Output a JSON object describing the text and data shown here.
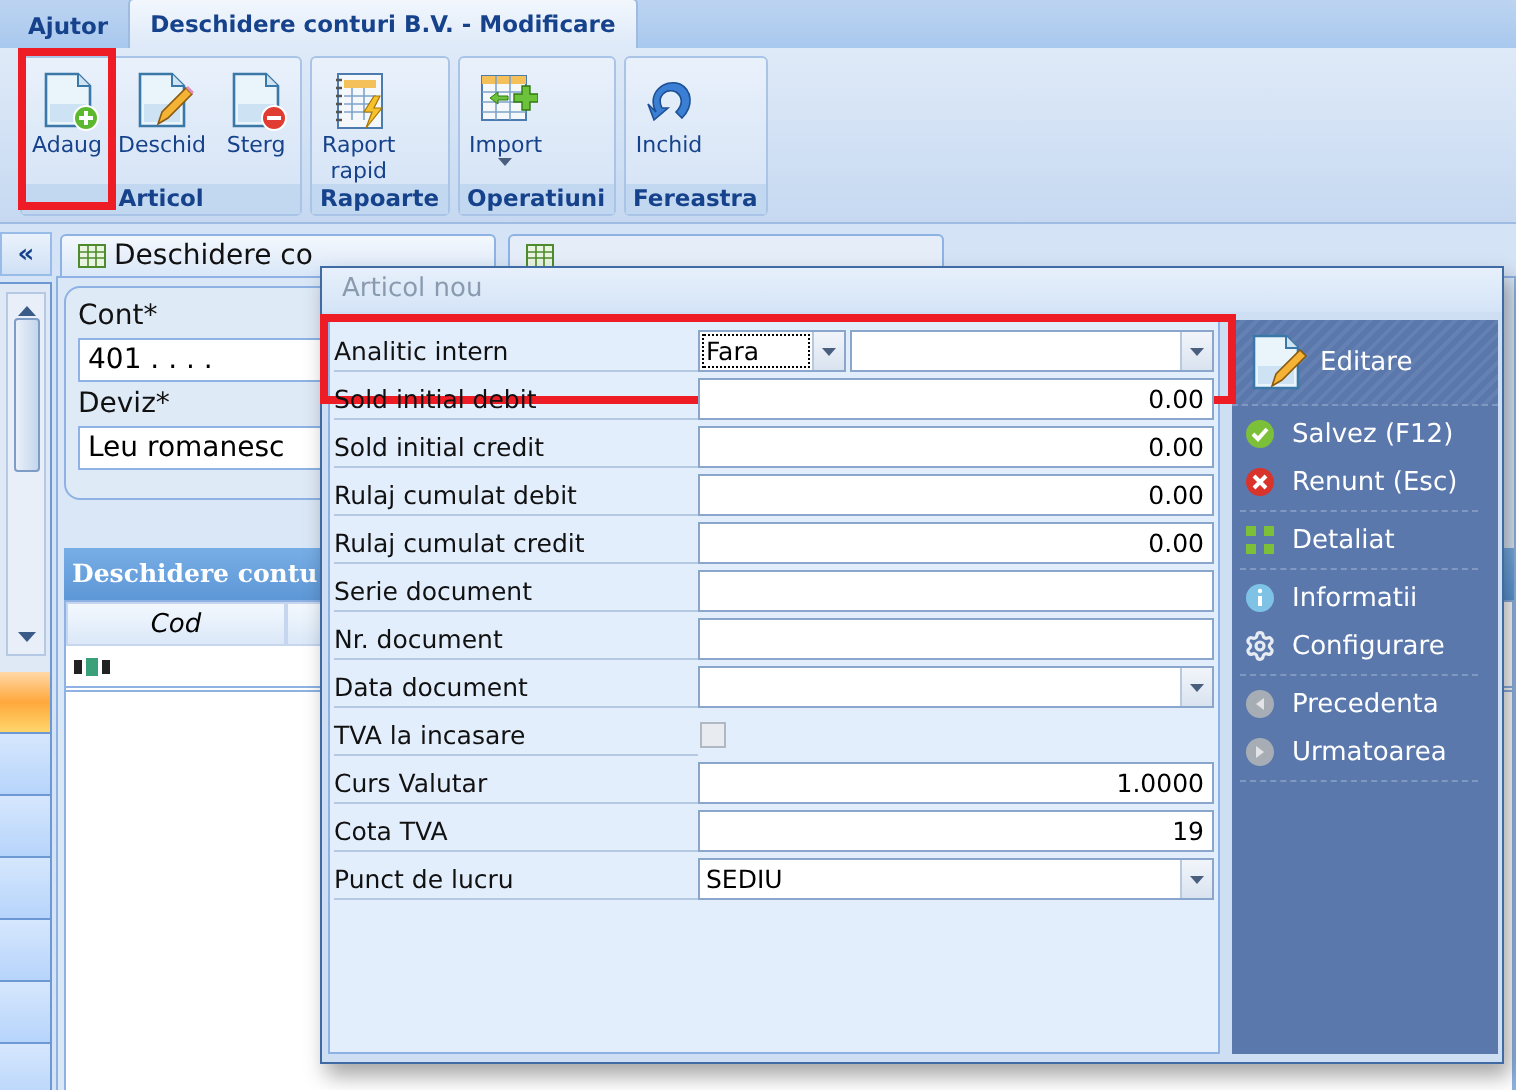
{
  "menu_tabs": [
    {
      "label": "Ajutor",
      "selected": false
    },
    {
      "label": "Deschidere conturi B.V. -  Modificare",
      "selected": true
    }
  ],
  "ribbon_groups": [
    {
      "label": "Articol",
      "buttons": [
        {
          "label": "Adaug",
          "kind": "add",
          "highlighted": true
        },
        {
          "label": "Deschid",
          "kind": "edit"
        },
        {
          "label": "Sterg",
          "kind": "delete"
        }
      ]
    },
    {
      "label": "Rapoarte",
      "buttons": [
        {
          "label": "Raport rapid",
          "kind": "report"
        }
      ]
    },
    {
      "label": "Operatiuni",
      "buttons": [
        {
          "label": "Import",
          "kind": "import",
          "dropdown": true
        }
      ]
    },
    {
      "label": "Fereastra",
      "buttons": [
        {
          "label": "Inchid",
          "kind": "close"
        }
      ]
    }
  ],
  "collapse_button": "«",
  "side_list": [
    {
      "selected": true
    },
    {
      "selected": false
    },
    {
      "selected": false
    },
    {
      "selected": false
    },
    {
      "selected": false
    },
    {
      "selected": false
    },
    {
      "selected": false
    }
  ],
  "doc_tabs": [
    {
      "label": "Deschidere co",
      "selected": true
    },
    {
      "selected": false
    }
  ],
  "fields": [
    {
      "label": "Cont*",
      "value": "401 . . . ."
    },
    {
      "label": "Deviz*",
      "value": "Leu romanesc"
    }
  ],
  "grid": {
    "title": "Deschidere contu",
    "columns": [
      "Cod"
    ]
  },
  "dialog": {
    "title": "Articol nou",
    "rows": [
      {
        "label": "Analitic intern",
        "kind": "dual-combo",
        "value": "Fara",
        "highlighted": true
      },
      {
        "label": "Sold initial debit",
        "kind": "number",
        "value": "0.00"
      },
      {
        "label": "Sold initial credit",
        "kind": "number",
        "value": "0.00"
      },
      {
        "label": "Rulaj cumulat debit",
        "kind": "number",
        "value": "0.00"
      },
      {
        "label": "Rulaj cumulat credit",
        "kind": "number",
        "value": "0.00"
      },
      {
        "label": "Serie document",
        "kind": "text"
      },
      {
        "label": "Nr. document",
        "kind": "text"
      },
      {
        "label": "Data document",
        "kind": "combo"
      },
      {
        "label": "TVA la incasare",
        "kind": "checkbox",
        "checked": false,
        "disabled": true
      },
      {
        "label": "Curs Valutar",
        "kind": "number",
        "value": "1.0000"
      },
      {
        "label": "Cota TVA",
        "kind": "number",
        "value": "19"
      },
      {
        "label": "Punct de lucru",
        "kind": "combo",
        "value": "SEDIU"
      }
    ],
    "panel": {
      "title": "Editare",
      "groups": [
        [
          {
            "label": "Salvez (F12)",
            "kind": "save",
            "disabled": false
          },
          {
            "label": "Renunt (Esc)",
            "kind": "cancel",
            "disabled": false
          }
        ],
        [
          {
            "label": "Detaliat",
            "kind": "detail",
            "disabled": false
          }
        ],
        [
          {
            "label": "Informatii",
            "kind": "info",
            "disabled": false
          },
          {
            "label": "Configurare",
            "kind": "settings",
            "disabled": false
          }
        ],
        [
          {
            "label": "Precedenta",
            "kind": "prev",
            "disabled": true
          },
          {
            "label": "Urmatoarea",
            "kind": "next",
            "disabled": true
          }
        ]
      ]
    }
  }
}
